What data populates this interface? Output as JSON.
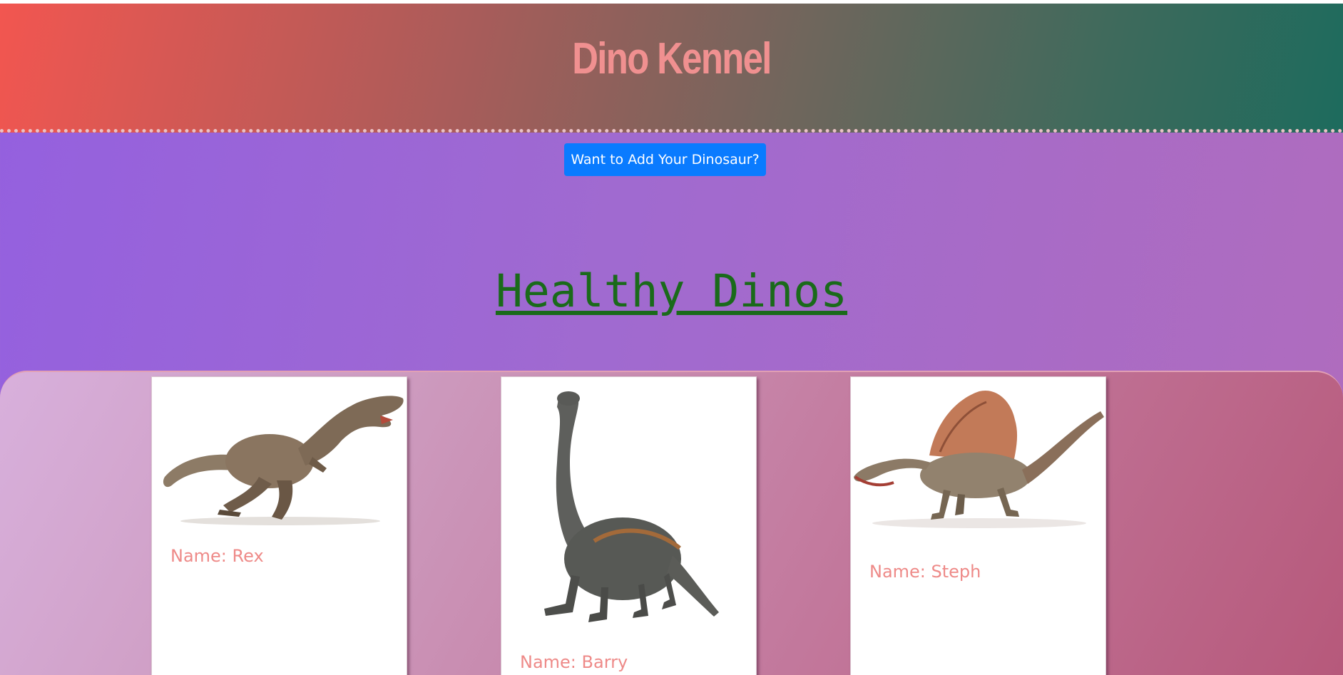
{
  "header": {
    "title": "Dino Kennel"
  },
  "actions": {
    "add_button_label": "Want to Add Your Dinosaur?"
  },
  "section": {
    "title": "Healthy Dinos"
  },
  "dinos": [
    {
      "name_label": "Name: Rex",
      "species_icon": "trex-image"
    },
    {
      "name_label": "Name: Barry",
      "species_icon": "sauropod-image"
    },
    {
      "name_label": "Name: Steph",
      "species_icon": "spinosaurus-image"
    }
  ],
  "colors": {
    "title": "#f09090",
    "button": "#0a7bff",
    "section_title": "#1a6a1a",
    "card_name": "#ee8a88"
  }
}
